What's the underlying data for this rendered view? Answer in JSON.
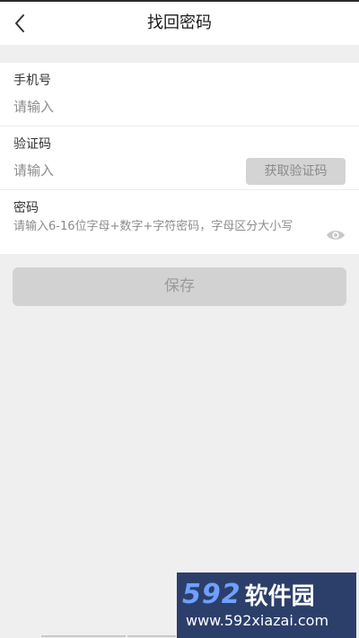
{
  "header": {
    "title": "找回密码",
    "back_icon": "chevron-left-icon"
  },
  "form": {
    "phone": {
      "label": "手机号",
      "placeholder": "请输入"
    },
    "code": {
      "label": "验证码",
      "placeholder": "请输入",
      "get_code_label": "获取验证码"
    },
    "password": {
      "label": "密码",
      "hint": "请输入6-16位字母+数字+字符密码，字母区分大小写",
      "toggle_icon": "eye-icon"
    }
  },
  "save_label": "保存",
  "watermark": {
    "number": "592",
    "brand": "软件园",
    "url": "www.592xiazai.com"
  },
  "colors": {
    "background": "#efefef",
    "disabled_button": "#d2d2d2",
    "watermark_bg": "#2c3f6b",
    "watermark_accent": "#6ea0ff"
  }
}
